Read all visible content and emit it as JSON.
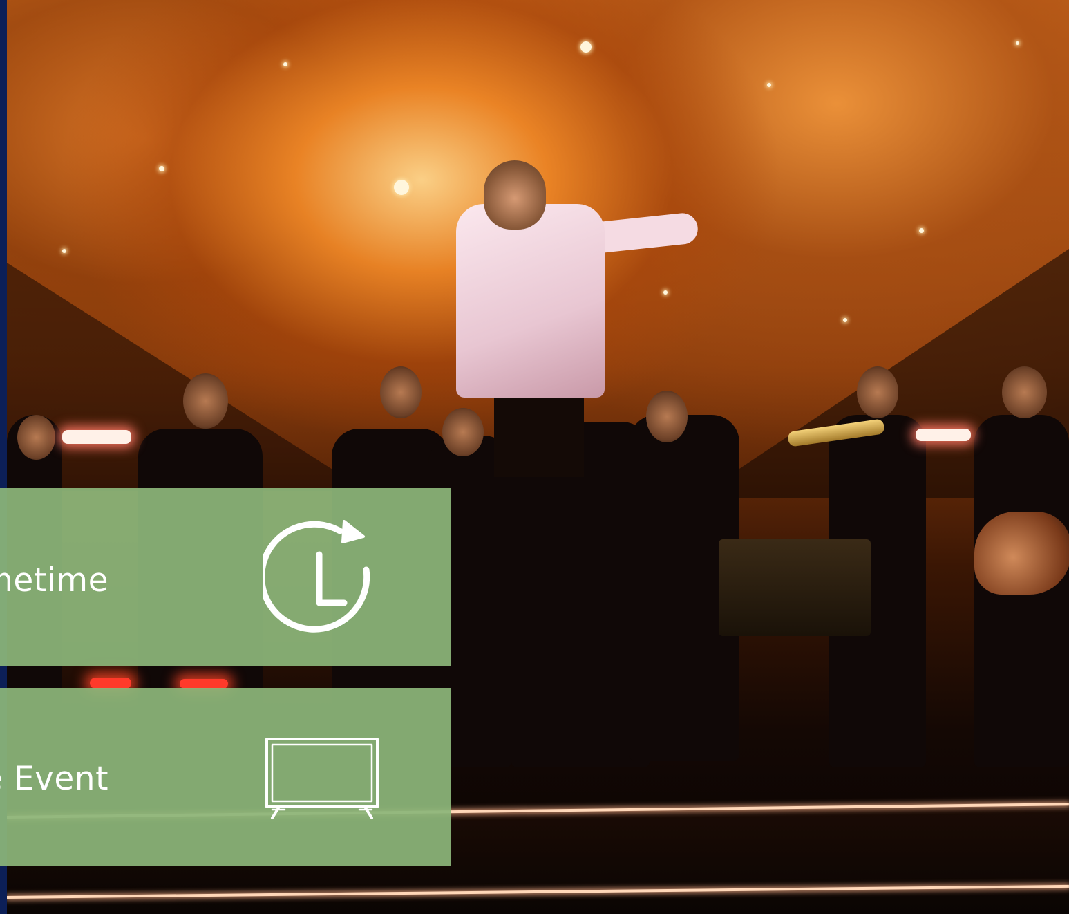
{
  "tiles": [
    {
      "label": "Primetime",
      "icon": "clock-replay-icon"
    },
    {
      "label": "Live Event",
      "icon": "tv-icon"
    }
  ],
  "colors": {
    "tile_background": "#8cb67a",
    "tile_text": "#ffffff",
    "left_edge": "#0c1f57"
  }
}
